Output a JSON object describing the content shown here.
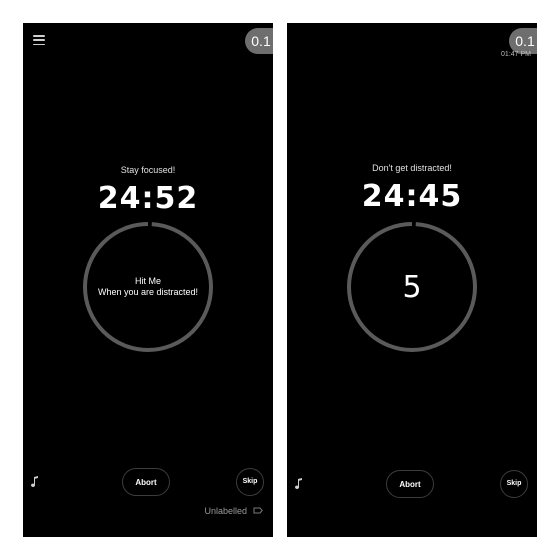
{
  "colors": {
    "background": "#000000",
    "ring": "#5a5a5a",
    "badge": "#6e6e6e",
    "text": "#ffffff",
    "muted_text": "#9a9a9a"
  },
  "left_screen": {
    "menu_icon": "hamburger-menu-icon",
    "badge": "0.1",
    "status": "Stay focused!",
    "timer": "24:52",
    "ring_progress": 0.99,
    "hit_title": "Hit Me",
    "hit_subtitle": "When you are distracted!",
    "music_icon": "music-note-icon",
    "abort_label": "Abort",
    "skip_label": "Skip",
    "label_text": "Unlabelled",
    "label_icon": "tag-icon"
  },
  "right_screen": {
    "badge": "0.1",
    "clock": "01:47 PM",
    "status": "Don't get distracted!",
    "timer": "24:45",
    "ring_progress": 0.99,
    "counter": "5",
    "music_icon": "music-note-icon",
    "abort_label": "Abort",
    "skip_label": "Skip"
  }
}
